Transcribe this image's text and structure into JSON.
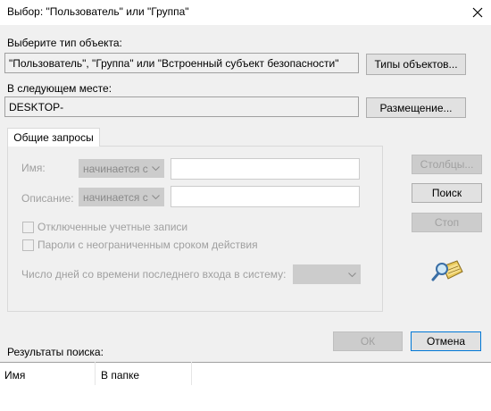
{
  "window": {
    "title": "Выбор: \"Пользователь\" или \"Группа\"",
    "close_icon": "close-icon"
  },
  "object_type": {
    "label": "Выберите тип объекта:",
    "value": "\"Пользователь\", \"Группа\" или \"Встроенный субъект безопасности\"",
    "button": "Типы объектов..."
  },
  "location": {
    "label": "В следующем месте:",
    "value": "DESKTOP-",
    "button": "Размещение..."
  },
  "tabs": [
    {
      "label": "Общие запросы",
      "active": true
    }
  ],
  "query": {
    "name_label": "Имя:",
    "name_combo": "начинается с",
    "desc_label": "Описание:",
    "desc_combo": "начинается с",
    "disabled_accounts": "Отключенные учетные записи",
    "nonexpiring_passwords": "Пароли с неограниченным сроком действия",
    "days_label": "Число дней со времени последнего входа в систему:"
  },
  "side_buttons": {
    "columns": "Столбцы...",
    "search": "Поиск",
    "stop": "Стоп"
  },
  "dialog_buttons": {
    "ok": "ОК",
    "cancel": "Отмена"
  },
  "results": {
    "label": "Результаты поиска:",
    "columns": [
      "Имя",
      "В папке"
    ]
  },
  "icons": {
    "search_icon": "magnifier-directory-icon"
  }
}
